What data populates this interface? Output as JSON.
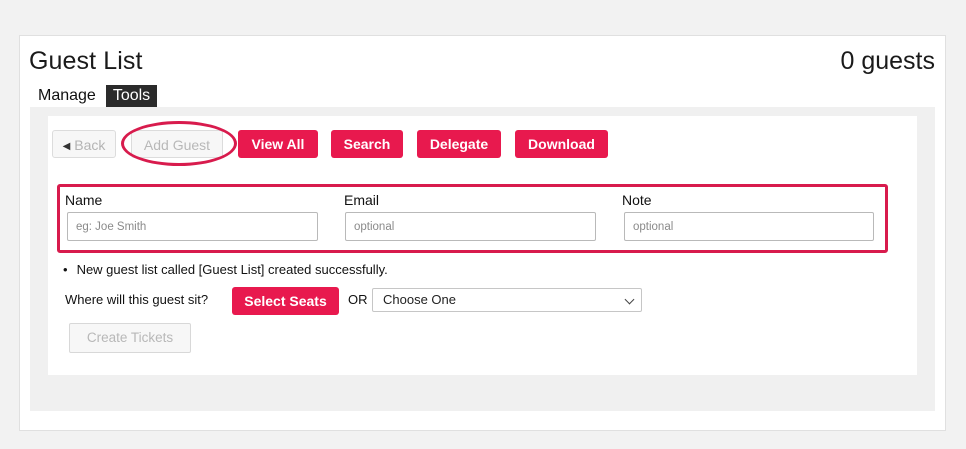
{
  "header": {
    "title": "Guest List",
    "guest_count": "0 guests"
  },
  "tabs": [
    {
      "label": "Manage",
      "active": false
    },
    {
      "label": "Tools",
      "active": true
    }
  ],
  "toolbar": {
    "back_label": "Back",
    "add_guest_label": "Add Guest",
    "view_all_label": "View All",
    "search_label": "Search",
    "delegate_label": "Delegate",
    "download_label": "Download"
  },
  "form": {
    "name_label": "Name",
    "name_placeholder": "eg: Joe Smith",
    "email_label": "Email",
    "email_placeholder": "optional",
    "note_label": "Note",
    "note_placeholder": "optional"
  },
  "messages": [
    "New guest list called [Guest List] created successfully."
  ],
  "seating": {
    "question": "Where will this guest sit?",
    "select_seats_label": "Select Seats",
    "or_label": "OR",
    "choose_value": "Choose One"
  },
  "create_tickets_label": "Create Tickets",
  "colors": {
    "accent": "#e8194e",
    "highlight": "#d81b4d",
    "tab_dark": "#2b2b2b"
  },
  "icons": {
    "back": "caret-left-icon",
    "dropdown": "chevron-down-icon"
  }
}
